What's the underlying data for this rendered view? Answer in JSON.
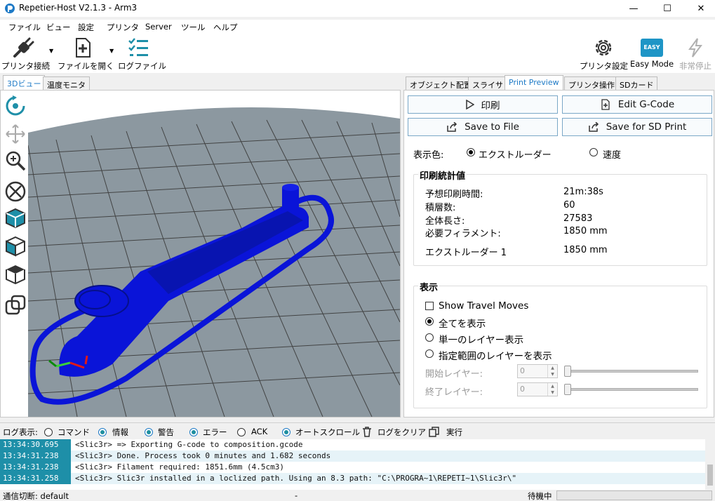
{
  "window": {
    "title": "Repetier-Host V2.1.3 - Arm3",
    "minimize_glyph": "—",
    "maximize_glyph": "☐",
    "close_glyph": "✕"
  },
  "menu": [
    "ファイル",
    "ビュー",
    "設定",
    "プリンタ",
    "Server",
    "ツール",
    "ヘルプ"
  ],
  "toolbar": {
    "connect": "プリンタ接続",
    "open_file": "ファイルを開く",
    "log_file": "ログファイル",
    "printer_settings": "プリンタ設定",
    "easy_mode": "Easy Mode",
    "easy_badge": "EASY",
    "emergency_stop": "非常停止",
    "dropdown_glyph": "▼"
  },
  "left_tabs": [
    "3Dビュー",
    "温度モニタ"
  ],
  "right_tabs": [
    "オブジェクト配置",
    "スライサ",
    "Print Preview",
    "プリンタ操作",
    "SDカード"
  ],
  "preview": {
    "print_label": "印刷",
    "edit_gcode_label": "Edit G-Code",
    "save_file_label": "Save to File",
    "save_sd_label": "Save for SD Print",
    "display_color_label": "表示色:",
    "color_extruder": "エクストルーダー",
    "color_speed": "速度",
    "stats_title": "印刷統計値",
    "stats": [
      {
        "label": "予想印刷時間:",
        "value": "21m:38s"
      },
      {
        "label": "積層数:",
        "value": "60"
      },
      {
        "label": "全体長さ:",
        "value": "27583"
      },
      {
        "label": "必要フィラメント:",
        "value": "1850 mm"
      }
    ],
    "extruder_label": "エクストルーダー 1",
    "extruder_value": "1850 mm",
    "display_title": "表示",
    "show_travel": "Show Travel Moves",
    "show_all": "全てを表示",
    "single_layer": "単一のレイヤー表示",
    "range_layers": "指定範囲のレイヤーを表示",
    "start_layer_label": "開始レイヤー:",
    "start_layer_value": "0",
    "end_layer_label": "終了レイヤー:",
    "end_layer_value": "0"
  },
  "log_bar": {
    "label": "ログ表示:",
    "command": "コマンド",
    "info": "情報",
    "warning": "警告",
    "error": "エラー",
    "ack": "ACK",
    "autoscroll": "オートスクロール",
    "clear": "ログをクリア",
    "run": "実行"
  },
  "log": [
    {
      "ts": "13:34:30.695",
      "msg": "<Slic3r> => Exporting G-code to composition.gcode"
    },
    {
      "ts": "13:34:31.238",
      "msg": "<Slic3r> Done. Process took 0 minutes and 1.682 seconds"
    },
    {
      "ts": "13:34:31.238",
      "msg": "<Slic3r> Filament required: 1851.6mm (4.5cm3)"
    },
    {
      "ts": "13:34:31.258",
      "msg": "<Slic3r> Slic3r installed in a loclized path. Using an 8.3 path: \"C:\\PROGRA~1\\REPETI~1\\Slic3r\\\""
    }
  ],
  "status": {
    "connection": "通信切断: default",
    "middle": "-",
    "state": "待機中"
  },
  "colors": {
    "accent": "#1e7ac6",
    "timestamp_bg": "#1e8fa8",
    "model_blue": "#0a14d8",
    "grid_floor": "#8c98a0"
  }
}
